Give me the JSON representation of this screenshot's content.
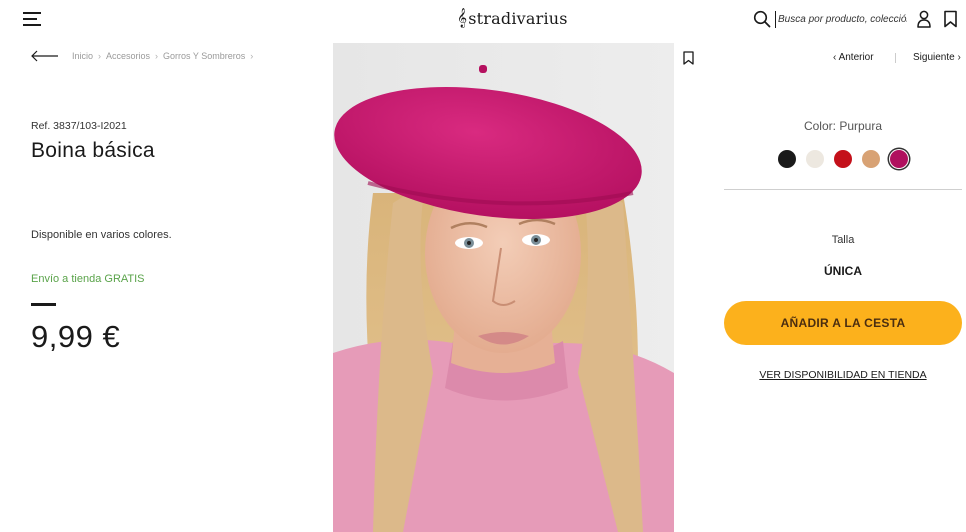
{
  "header": {
    "brand": "stradivarius",
    "brand_mark": "ᶔ",
    "search_placeholder": "Busca por producto, colección..."
  },
  "breadcrumb": [
    "Inicio",
    "Accesorios",
    "Gorros Y Sombreros"
  ],
  "product": {
    "ref": "Ref. 3837/103-I2021",
    "title": "Boina básica",
    "availability": "Disponible en varios colores.",
    "shipping": "Envío a tienda GRATIS",
    "price": "9,99 €",
    "color_label": "Color: Purpura",
    "size_label": "Talla",
    "size_value": "ÚNICA",
    "add_to_cart": "AÑADIR A LA CESTA",
    "store_availability": "VER DISPONIBILIDAD EN TIENDA"
  },
  "nav": {
    "prev": "Anterior",
    "next": "Siguiente"
  },
  "swatches": [
    {
      "name": "black",
      "color": "#1a1a1a",
      "selected": false
    },
    {
      "name": "cream",
      "color": "#ede8e0",
      "selected": false
    },
    {
      "name": "red",
      "color": "#c4101a",
      "selected": false
    },
    {
      "name": "camel",
      "color": "#d8a274",
      "selected": false
    },
    {
      "name": "purple",
      "color": "#b0105e",
      "selected": true
    }
  ],
  "colors": {
    "accent": "#fcb11c",
    "shipping_green": "#5aa34a",
    "beret": "#c8176d"
  }
}
